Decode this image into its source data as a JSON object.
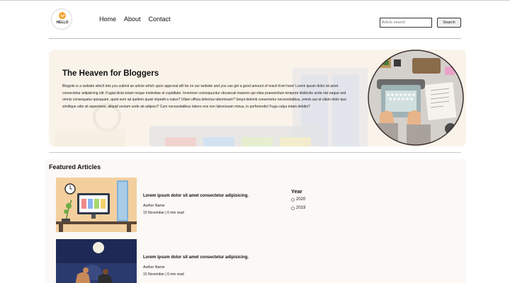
{
  "brand": {
    "logo_text": "HELLO"
  },
  "nav": {
    "items": [
      "Home",
      "About",
      "Contact"
    ]
  },
  "search": {
    "placeholder": "Article search",
    "button_label": "Search"
  },
  "hero": {
    "title": "The Heaven for Bloggers",
    "body": "Blogsite is a website which lets you submit an article which upon approval will be on our website and you can get a good amount of reach from here! Lorem ipsum dolor sit amet consectetur adipisicing elit. Fugiat dicta totam neque molestiae et cupiditate. Inventore consequuntur obcaecati maiores qui vitae praesentium tempore distinctio unde nisi eaque sed omnis consequatur quisquam, quod eum ad quidem quasi impedit a natus? Ullam officia delectus laboriosam? Sequi deleniti consectetur necessitatibus, omnis aut at ullam dolor quo similique odio sit asperiores, aliquid veniam unde ab adipisci? Cum necessitatibus labore eos non laboriosam minus, in perferendis! Fuga culpa totam debitis?"
  },
  "featured": {
    "title": "Featured Articles",
    "articles": [
      {
        "title": "Lorem ipsum dolor sit amet consectetur adipisicing.",
        "author": "Author Name",
        "meta": "15 November | 6 min read"
      },
      {
        "title": "Lorem ipsum dolor sit amet consectetur adipisicing.",
        "author": "Author Name",
        "meta": "15 November | 6 min read"
      }
    ]
  },
  "filter": {
    "title": "Year",
    "options": [
      "2020",
      "2019"
    ]
  }
}
